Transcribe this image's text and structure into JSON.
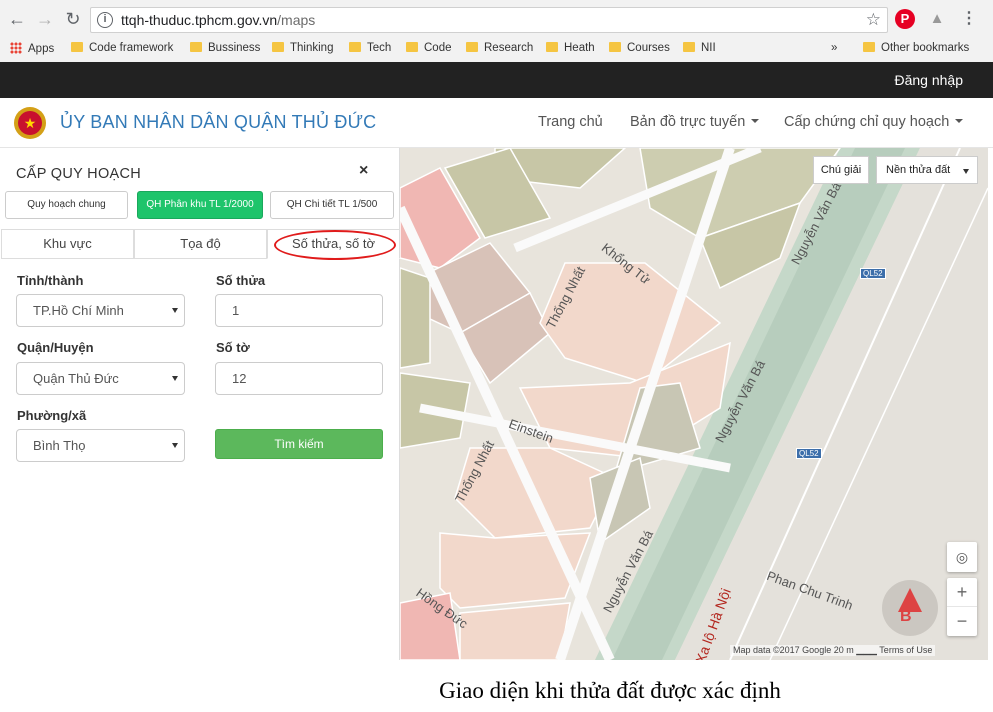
{
  "browser": {
    "url_host": "ttqh-thuduc.tphcm.gov.vn",
    "url_path": "/maps",
    "bookmarks": [
      "Apps",
      "Code framework",
      "Bussiness",
      "Thinking",
      "Tech",
      "Code",
      "Research",
      "Heath",
      "Courses",
      "NII",
      "»",
      "Other bookmarks"
    ]
  },
  "topbar": {
    "login": "Đăng nhập"
  },
  "header": {
    "brand": "ỦY BAN NHÂN DÂN QUẬN THỦ ĐỨC",
    "menu": [
      "Trang chủ",
      "Bản đồ trực tuyến",
      "Cấp chứng chỉ quy hoạch"
    ]
  },
  "panel": {
    "title": "CẤP QUY HOẠCH",
    "close": "×",
    "plan_buttons": [
      "Quy hoạch chung",
      "QH Phân khu TL 1/2000",
      "QH Chi tiết TL 1/500"
    ],
    "tabs": [
      "Khu vực",
      "Tọa độ",
      "Số thửa, số tờ"
    ],
    "labels": {
      "province": "Tỉnh/thành",
      "district": "Quận/Huyện",
      "ward": "Phường/xã",
      "parcel": "Số thửa",
      "sheet": "Số tờ"
    },
    "values": {
      "province": "TP.Hồ Chí Minh",
      "district": "Quận Thủ Đức",
      "ward": "Bình Thọ",
      "parcel": "1",
      "sheet": "12"
    },
    "search_button": "Tìm kiếm"
  },
  "map": {
    "legend_button": "Chú giải",
    "layer_select": "Nền thửa đất",
    "street_labels": [
      "Nguyễn Văn Bá",
      "Khổng Tử",
      "Thống Nhất",
      "Nguyễn Văn Bá",
      "Einstein",
      "Thống Nhất",
      "Nguyễn Văn Bá",
      "Phan Chu Trinh",
      "Hồng Đức",
      "Xa lộ Hà Nội"
    ],
    "route_badges": [
      "QL52",
      "QL52"
    ],
    "attribution": "Map data ©2017 Google   20 m ▁▁▁   Terms of Use",
    "zoom_in": "+",
    "zoom_out": "−"
  },
  "caption": "Giao diện khi thửa đất được xác định"
}
